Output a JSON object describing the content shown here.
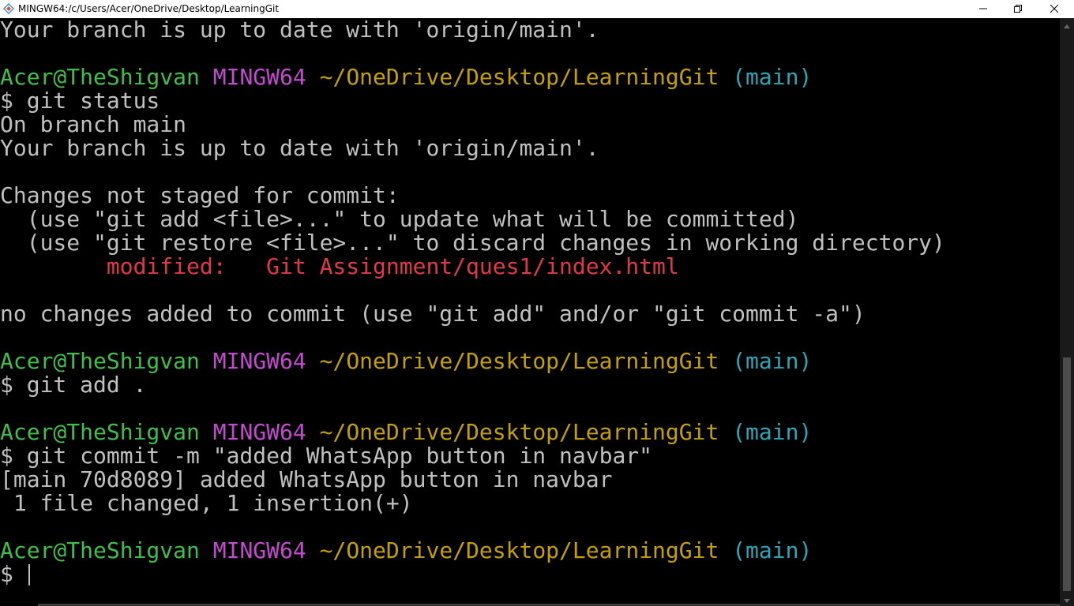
{
  "window": {
    "title": "MINGW64:/c/Users/Acer/OneDrive/Desktop/LearningGit",
    "icon": "mingw-terminal-icon"
  },
  "controls": {
    "minimize_icon": "minimize-icon",
    "maximize_icon": "restore-icon",
    "close_icon": "close-icon"
  },
  "colors": {
    "background": "#000000",
    "text": "#c0c0c0",
    "user": "#3fc04a",
    "system": "#c44bd0",
    "path": "#c4a000",
    "branch": "#2aa8b8",
    "modified": "#e03a4a"
  },
  "terminal": {
    "lines": [
      [
        {
          "t": "Your branch is up to date with 'origin/main'."
        }
      ],
      [],
      [
        {
          "t": "Acer@TheShigvan",
          "c": "user"
        },
        {
          "t": " "
        },
        {
          "t": "MINGW64",
          "c": "sys"
        },
        {
          "t": " "
        },
        {
          "t": "~/OneDrive/Desktop/LearningGit",
          "c": "path"
        },
        {
          "t": " "
        },
        {
          "t": "(main)",
          "c": "branch"
        }
      ],
      [
        {
          "t": "$ git status"
        }
      ],
      [
        {
          "t": "On branch main"
        }
      ],
      [
        {
          "t": "Your branch is up to date with 'origin/main'."
        }
      ],
      [],
      [
        {
          "t": "Changes not staged for commit:"
        }
      ],
      [
        {
          "t": "  (use \"git add <file>...\" to update what will be committed)"
        }
      ],
      [
        {
          "t": "  (use \"git restore <file>...\" to discard changes in working directory)"
        }
      ],
      [
        {
          "t": "        modified:   Git Assignment/ques1/index.html",
          "c": "red"
        }
      ],
      [],
      [
        {
          "t": "no changes added to commit (use \"git add\" and/or \"git commit -a\")"
        }
      ],
      [],
      [
        {
          "t": "Acer@TheShigvan",
          "c": "user"
        },
        {
          "t": " "
        },
        {
          "t": "MINGW64",
          "c": "sys"
        },
        {
          "t": " "
        },
        {
          "t": "~/OneDrive/Desktop/LearningGit",
          "c": "path"
        },
        {
          "t": " "
        },
        {
          "t": "(main)",
          "c": "branch"
        }
      ],
      [
        {
          "t": "$ git add ."
        }
      ],
      [],
      [
        {
          "t": "Acer@TheShigvan",
          "c": "user"
        },
        {
          "t": " "
        },
        {
          "t": "MINGW64",
          "c": "sys"
        },
        {
          "t": " "
        },
        {
          "t": "~/OneDrive/Desktop/LearningGit",
          "c": "path"
        },
        {
          "t": " "
        },
        {
          "t": "(main)",
          "c": "branch"
        }
      ],
      [
        {
          "t": "$ git commit -m \"added WhatsApp button in navbar\""
        }
      ],
      [
        {
          "t": "[main 70d8089] added WhatsApp button in navbar"
        }
      ],
      [
        {
          "t": " 1 file changed, 1 insertion(+)"
        }
      ],
      [],
      [
        {
          "t": "Acer@TheShigvan",
          "c": "user"
        },
        {
          "t": " "
        },
        {
          "t": "MINGW64",
          "c": "sys"
        },
        {
          "t": " "
        },
        {
          "t": "~/OneDrive/Desktop/LearningGit",
          "c": "path"
        },
        {
          "t": " "
        },
        {
          "t": "(main)",
          "c": "branch"
        }
      ],
      [
        {
          "t": "$ "
        }
      ]
    ]
  }
}
